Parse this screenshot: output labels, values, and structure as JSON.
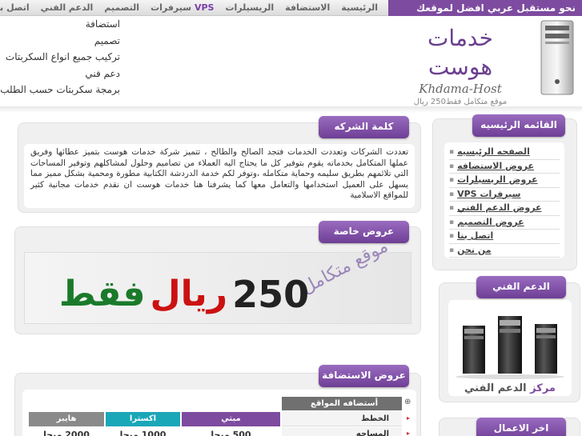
{
  "nav": {
    "items": [
      "الرئيسية",
      "الاستضافة",
      "الريسيلرات",
      "سيرفرات",
      "التصميم",
      "الدعم الفني",
      "اتصل بنا"
    ],
    "vps_label": "VPS"
  },
  "tagline": "نحو مستقبل عربي افضل لموقعك",
  "dropdown": {
    "items": [
      "استضافة",
      "تصميم",
      "تركيب جميع انواع السكربتات",
      "دعم فني",
      "برمجة سكربتات حسب الطلب"
    ]
  },
  "logo": {
    "arabic": "خدمات هوست",
    "english": "Khdama-Host",
    "subtitle": "موقع متكامل فقط250 ريال"
  },
  "main_menu": {
    "title": "القائمه الرئيسيه",
    "items": [
      "الصفحه الرئيسيه",
      "عروض الاستضافه",
      "عروض الريسيلرات",
      "سيرفرات VPS",
      "عروض الدعم الفني",
      "عروض التصميم",
      "اتصل بنا",
      "من نحن"
    ]
  },
  "support": {
    "title": "الدعم الفني",
    "caption_highlight": "مركز",
    "caption_rest": "الدعم الفني"
  },
  "works": {
    "title": "اخر الاعمال"
  },
  "about": {
    "title": "كلمة الشركه",
    "text": "تعددت الشركات وتعددت الخدمات فتجد الصالح والطالح ، تتميز شركة خدمات هوست بتميز عطائها وفريق عملها المتكامل بخدماته يقوم بتوفير كل ما يحتاج اليه العملاء من تصاميم وحلول لمشاكلهم وتوفير المساحات التي تلائمهم بطريق سليمه وحماية متكامله ،وتوفر لكم خدمة الدردشة الكتابية مطورة ومحمية بشكل مميز مما يسهل على العميل استخدامها والتعامل معها كما يشرفنا هنا خدمات هوست ان نقدم خدمات مجانية كثير للمواقع الاسلامية"
  },
  "offers": {
    "title": "عروض خاصة",
    "price": "250",
    "currency": "ريال",
    "only": "فقط",
    "site_label": "موقع متكامل"
  },
  "hosting": {
    "title": "عروض الاستضافة",
    "header": "أستضافه المواقع",
    "plans": [
      {
        "name": "مبتي",
        "color": "#7d4b9f"
      },
      {
        "name": "اكسترا",
        "color": "#1aa7b8"
      },
      {
        "name": "هايبر",
        "color": "#8a8a8a"
      }
    ],
    "rows": [
      {
        "label": "الخطط",
        "values": [
          "",
          "",
          ""
        ]
      },
      {
        "label": "المساحه",
        "values": [
          "500 ميجا",
          "1000 ميجا",
          "2000 ميجا"
        ]
      }
    ]
  }
}
